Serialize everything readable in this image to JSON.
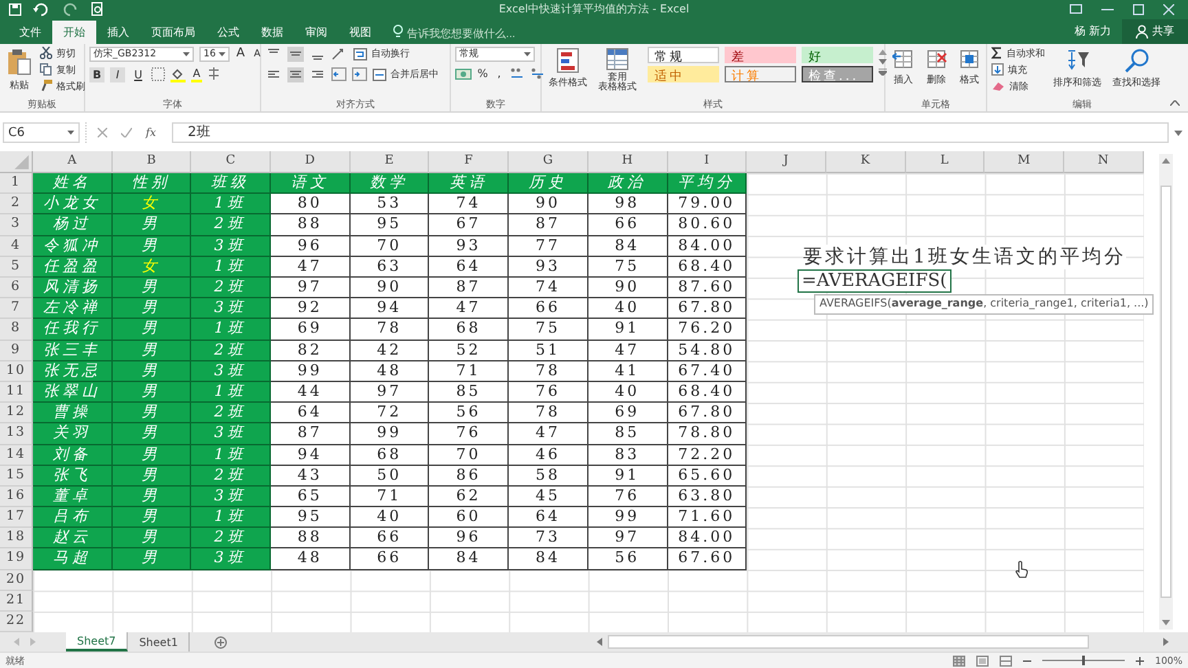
{
  "window": {
    "title": "Excel中快速计算平均值的方法 - Excel"
  },
  "tabs": [
    {
      "label": "文件",
      "selected": false
    },
    {
      "label": "开始",
      "selected": true
    },
    {
      "label": "插入",
      "selected": false
    },
    {
      "label": "页面布局",
      "selected": false
    },
    {
      "label": "公式",
      "selected": false
    },
    {
      "label": "数据",
      "selected": false
    },
    {
      "label": "审阅",
      "selected": false
    },
    {
      "label": "视图",
      "selected": false
    }
  ],
  "tell_me": {
    "placeholder": "告诉我您想要做什么..."
  },
  "user": "杨 新力",
  "share": "共享",
  "ribbon": {
    "clipboard": {
      "label": "剪贴板",
      "paste": "粘贴",
      "cut": "剪切",
      "copy": "复制",
      "painter": "格式刷"
    },
    "font": {
      "label": "字体",
      "name": "仿宋_GB2312",
      "size": "16",
      "grow": "A",
      "shrink": "A",
      "styles": [
        "B",
        "I",
        "U"
      ],
      "font_color": "A"
    },
    "alignment": {
      "label": "对齐方式",
      "wrap": "自动换行",
      "merge": "合并后居中"
    },
    "number": {
      "label": "数字",
      "format": "常规",
      "percent": "%",
      "comma": ","
    },
    "styles": {
      "label": "样式",
      "conditional": "条件格式",
      "table_format": [
        "套用",
        "表格格式"
      ],
      "cell_styles": [
        {
          "label": "常规",
          "kind": "normal"
        },
        {
          "label": "差",
          "kind": "bad"
        },
        {
          "label": "好",
          "kind": "good"
        },
        {
          "label": "适中",
          "kind": "neutral"
        },
        {
          "label": "计算",
          "kind": "calc"
        },
        {
          "label": "检查...",
          "kind": "check"
        }
      ]
    },
    "cells": {
      "label": "单元格",
      "buttons": [
        "插入",
        "删除",
        "格式"
      ]
    },
    "editing": {
      "label": "编辑",
      "autosum": "自动求和",
      "fill": "填充",
      "clear": "清除",
      "sort": "排序和筛选",
      "find": "查找和选择"
    }
  },
  "formula_bar": {
    "name_box": "C6",
    "fx": "fx",
    "content": "2班"
  },
  "columns": [
    "A",
    "B",
    "C",
    "D",
    "E",
    "F",
    "G",
    "H",
    "I",
    "J",
    "K",
    "L",
    "M",
    "N"
  ],
  "row_numbers": [
    "1",
    "2",
    "3",
    "4",
    "5",
    "6",
    "7",
    "8",
    "9",
    "10",
    "11",
    "12",
    "13",
    "14",
    "15",
    "16",
    "17",
    "18",
    "19",
    "20",
    "21",
    "22"
  ],
  "header": [
    "姓名",
    "性别",
    "班级",
    "语文",
    "数学",
    "英语",
    "历史",
    "政治",
    "平均分"
  ],
  "rows": [
    {
      "cells": [
        "小龙女",
        "女",
        "1班",
        "80",
        "53",
        "74",
        "90",
        "98",
        "79.00"
      ],
      "highlighted": true
    },
    {
      "cells": [
        "杨过",
        "男",
        "2班",
        "88",
        "95",
        "67",
        "87",
        "66",
        "80.60"
      ],
      "highlighted": false
    },
    {
      "cells": [
        "令狐冲",
        "男",
        "3班",
        "96",
        "70",
        "93",
        "77",
        "84",
        "84.00"
      ],
      "highlighted": false
    },
    {
      "cells": [
        "任盈盈",
        "女",
        "1班",
        "47",
        "63",
        "64",
        "93",
        "75",
        "68.40"
      ],
      "highlighted": true
    },
    {
      "cells": [
        "风清扬",
        "男",
        "2班",
        "97",
        "90",
        "87",
        "74",
        "90",
        "87.60"
      ],
      "highlighted": false
    },
    {
      "cells": [
        "左冷禅",
        "男",
        "3班",
        "92",
        "94",
        "47",
        "66",
        "40",
        "67.80"
      ],
      "highlighted": false
    },
    {
      "cells": [
        "任我行",
        "男",
        "1班",
        "69",
        "78",
        "68",
        "75",
        "91",
        "76.20"
      ],
      "highlighted": false
    },
    {
      "cells": [
        "张三丰",
        "男",
        "2班",
        "82",
        "42",
        "52",
        "51",
        "47",
        "54.80"
      ],
      "highlighted": false
    },
    {
      "cells": [
        "张无忌",
        "男",
        "3班",
        "99",
        "48",
        "71",
        "78",
        "41",
        "67.40"
      ],
      "highlighted": false
    },
    {
      "cells": [
        "张翠山",
        "男",
        "1班",
        "44",
        "97",
        "85",
        "76",
        "40",
        "68.40"
      ],
      "highlighted": false
    },
    {
      "cells": [
        "曹操",
        "男",
        "2班",
        "64",
        "72",
        "56",
        "78",
        "69",
        "67.80"
      ],
      "highlighted": false
    },
    {
      "cells": [
        "关羽",
        "男",
        "3班",
        "87",
        "99",
        "76",
        "47",
        "85",
        "78.80"
      ],
      "highlighted": false
    },
    {
      "cells": [
        "刘备",
        "男",
        "1班",
        "94",
        "68",
        "70",
        "46",
        "83",
        "72.20"
      ],
      "highlighted": false
    },
    {
      "cells": [
        "张飞",
        "男",
        "2班",
        "43",
        "50",
        "86",
        "58",
        "91",
        "65.60"
      ],
      "highlighted": false
    },
    {
      "cells": [
        "董卓",
        "男",
        "3班",
        "65",
        "71",
        "62",
        "45",
        "76",
        "63.80"
      ],
      "highlighted": false
    },
    {
      "cells": [
        "吕布",
        "男",
        "1班",
        "95",
        "40",
        "60",
        "64",
        "99",
        "71.60"
      ],
      "highlighted": false
    },
    {
      "cells": [
        "赵云",
        "男",
        "2班",
        "88",
        "66",
        "96",
        "73",
        "97",
        "84.00"
      ],
      "highlighted": false
    },
    {
      "cells": [
        "马超",
        "男",
        "3班",
        "48",
        "66",
        "84",
        "84",
        "56",
        "67.60"
      ],
      "highlighted": false
    }
  ],
  "note": "要求计算出1班女生语文的平均分",
  "editing_cell": {
    "value": "=AVERAGEIFS("
  },
  "tooltip": "AVERAGEIFS(**average_range**, criteria_range1, criteria1, ...)",
  "sheet_tabs": [
    {
      "label": "Sheet7",
      "selected": true
    },
    {
      "label": "Sheet1",
      "selected": false
    }
  ],
  "status_bar": {
    "status": "就绪",
    "zoom": {
      "level": 0.5,
      "reading": "100%"
    }
  }
}
